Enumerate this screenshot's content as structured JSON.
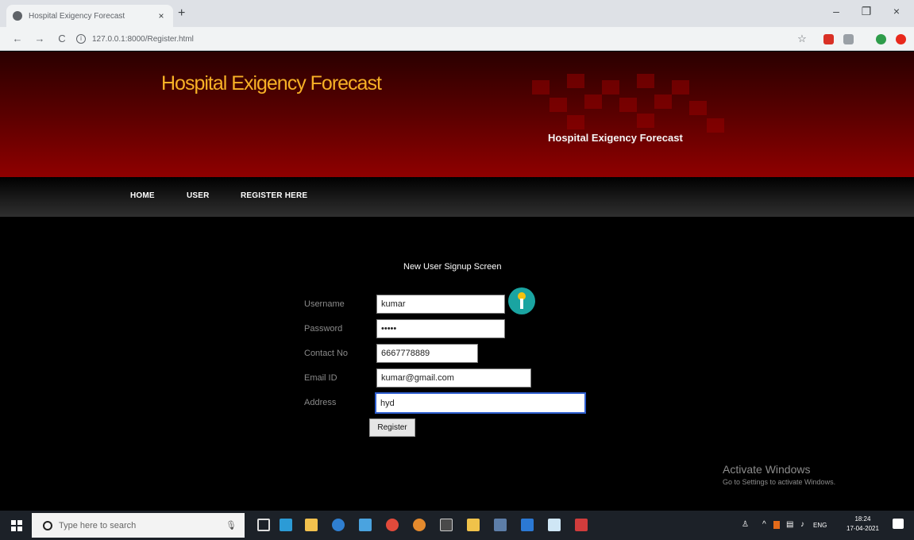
{
  "browser": {
    "tab_title": "Hospital Exigency Forecast",
    "tab_close": "×",
    "new_tab": "+",
    "url": "127.0.0.1:8000/Register.html",
    "nav_back": "←",
    "nav_forward": "→",
    "nav_reload": "C",
    "bookmark_star": "☆",
    "minimize": "–",
    "maximize": "❐",
    "close": "×"
  },
  "site": {
    "title": "Hospital Exigency Forecast",
    "tagline": "Hospital Exigency Forecast"
  },
  "nav": {
    "items": [
      {
        "label": "HOME"
      },
      {
        "label": "USER"
      },
      {
        "label": "REGISTER HERE"
      }
    ]
  },
  "form": {
    "title": "New User Signup Screen",
    "username_label": "Username",
    "username_value": "kumar",
    "password_label": "Password",
    "password_value": "•••••",
    "contact_label": "Contact No",
    "contact_value": "6667778889",
    "email_label": "Email ID",
    "email_value": "kumar@gmail.com",
    "address_label": "Address",
    "address_value": "hyd",
    "register_label": "Register"
  },
  "watermark": {
    "line1": "Activate Windows",
    "line2": "Go to Settings to activate Windows."
  },
  "taskbar": {
    "search_placeholder": "Type here to search",
    "mic": "🎙",
    "tray_arrow": "^",
    "tray_lang": "ENG",
    "time": "18:24",
    "date": "17-04-2021"
  },
  "colors": {
    "title_orange": "#f7b126",
    "header_red": "#8f0000",
    "focus_blue": "#2f5fd0"
  }
}
